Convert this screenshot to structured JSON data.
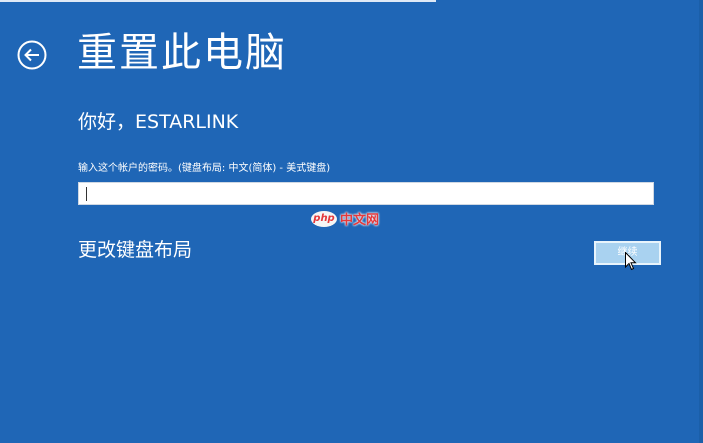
{
  "screen": {
    "title": "重置此电脑",
    "greeting": "你好，ESTARLINK",
    "background_color": "#1f66b6"
  },
  "back_button": {
    "icon": "back-arrow-icon"
  },
  "password": {
    "label": "输入这个帐户的密码。(键盘布局: 中文(简体) - 美式键盘)",
    "value": ""
  },
  "keyboard_layout_link": {
    "label": "更改键盘布局"
  },
  "continue_button": {
    "label": "继续"
  },
  "watermark": {
    "badge": "php",
    "text": "中文网",
    "color": "#e4393c"
  }
}
